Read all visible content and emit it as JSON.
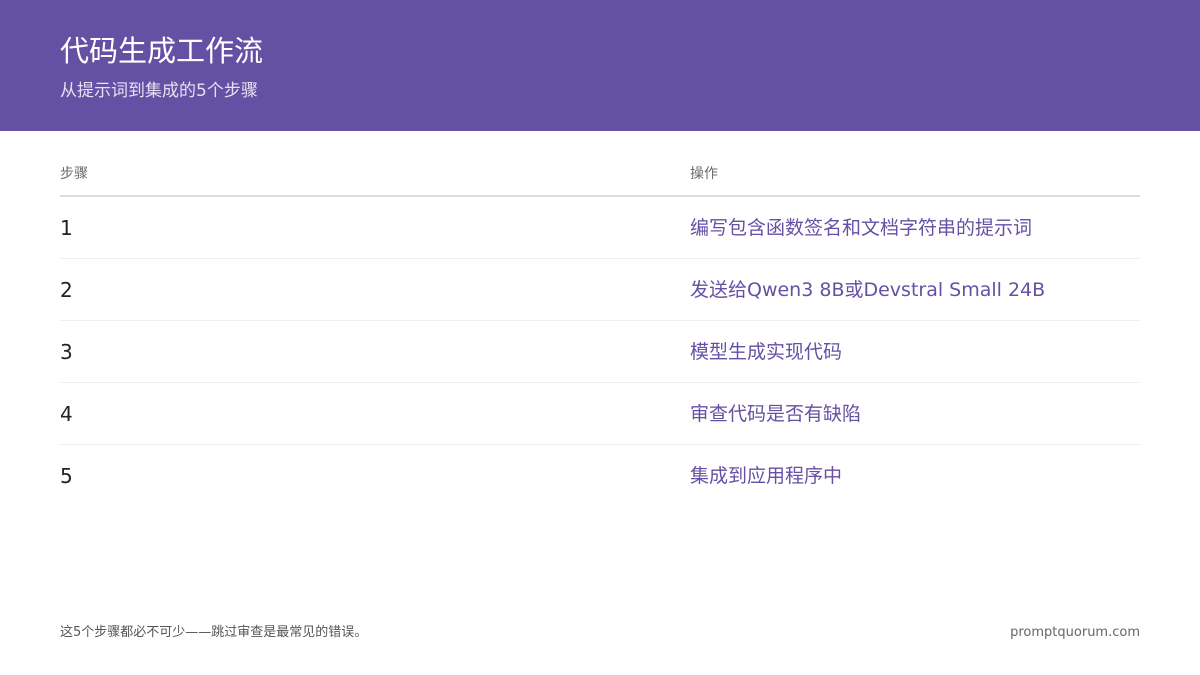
{
  "header": {
    "title": "代码生成工作流",
    "subtitle": "从提示词到集成的5个步骤"
  },
  "table": {
    "columns": [
      "步骤",
      "操作"
    ],
    "rows": [
      {
        "step": "1",
        "action": "编写包含函数签名和文档字符串的提示词"
      },
      {
        "step": "2",
        "action": "发送给Qwen3 8B或Devstral Small 24B"
      },
      {
        "step": "3",
        "action": "模型生成实现代码"
      },
      {
        "step": "4",
        "action": "审查代码是否有缺陷"
      },
      {
        "step": "5",
        "action": "集成到应用程序中"
      }
    ]
  },
  "footer": {
    "note": "这5个步骤都必不可少——跳过审查是最常见的错误。",
    "site": "promptquorum.com"
  },
  "colors": {
    "header_bg": "#6650a4",
    "accent_text": "#6650a4"
  }
}
